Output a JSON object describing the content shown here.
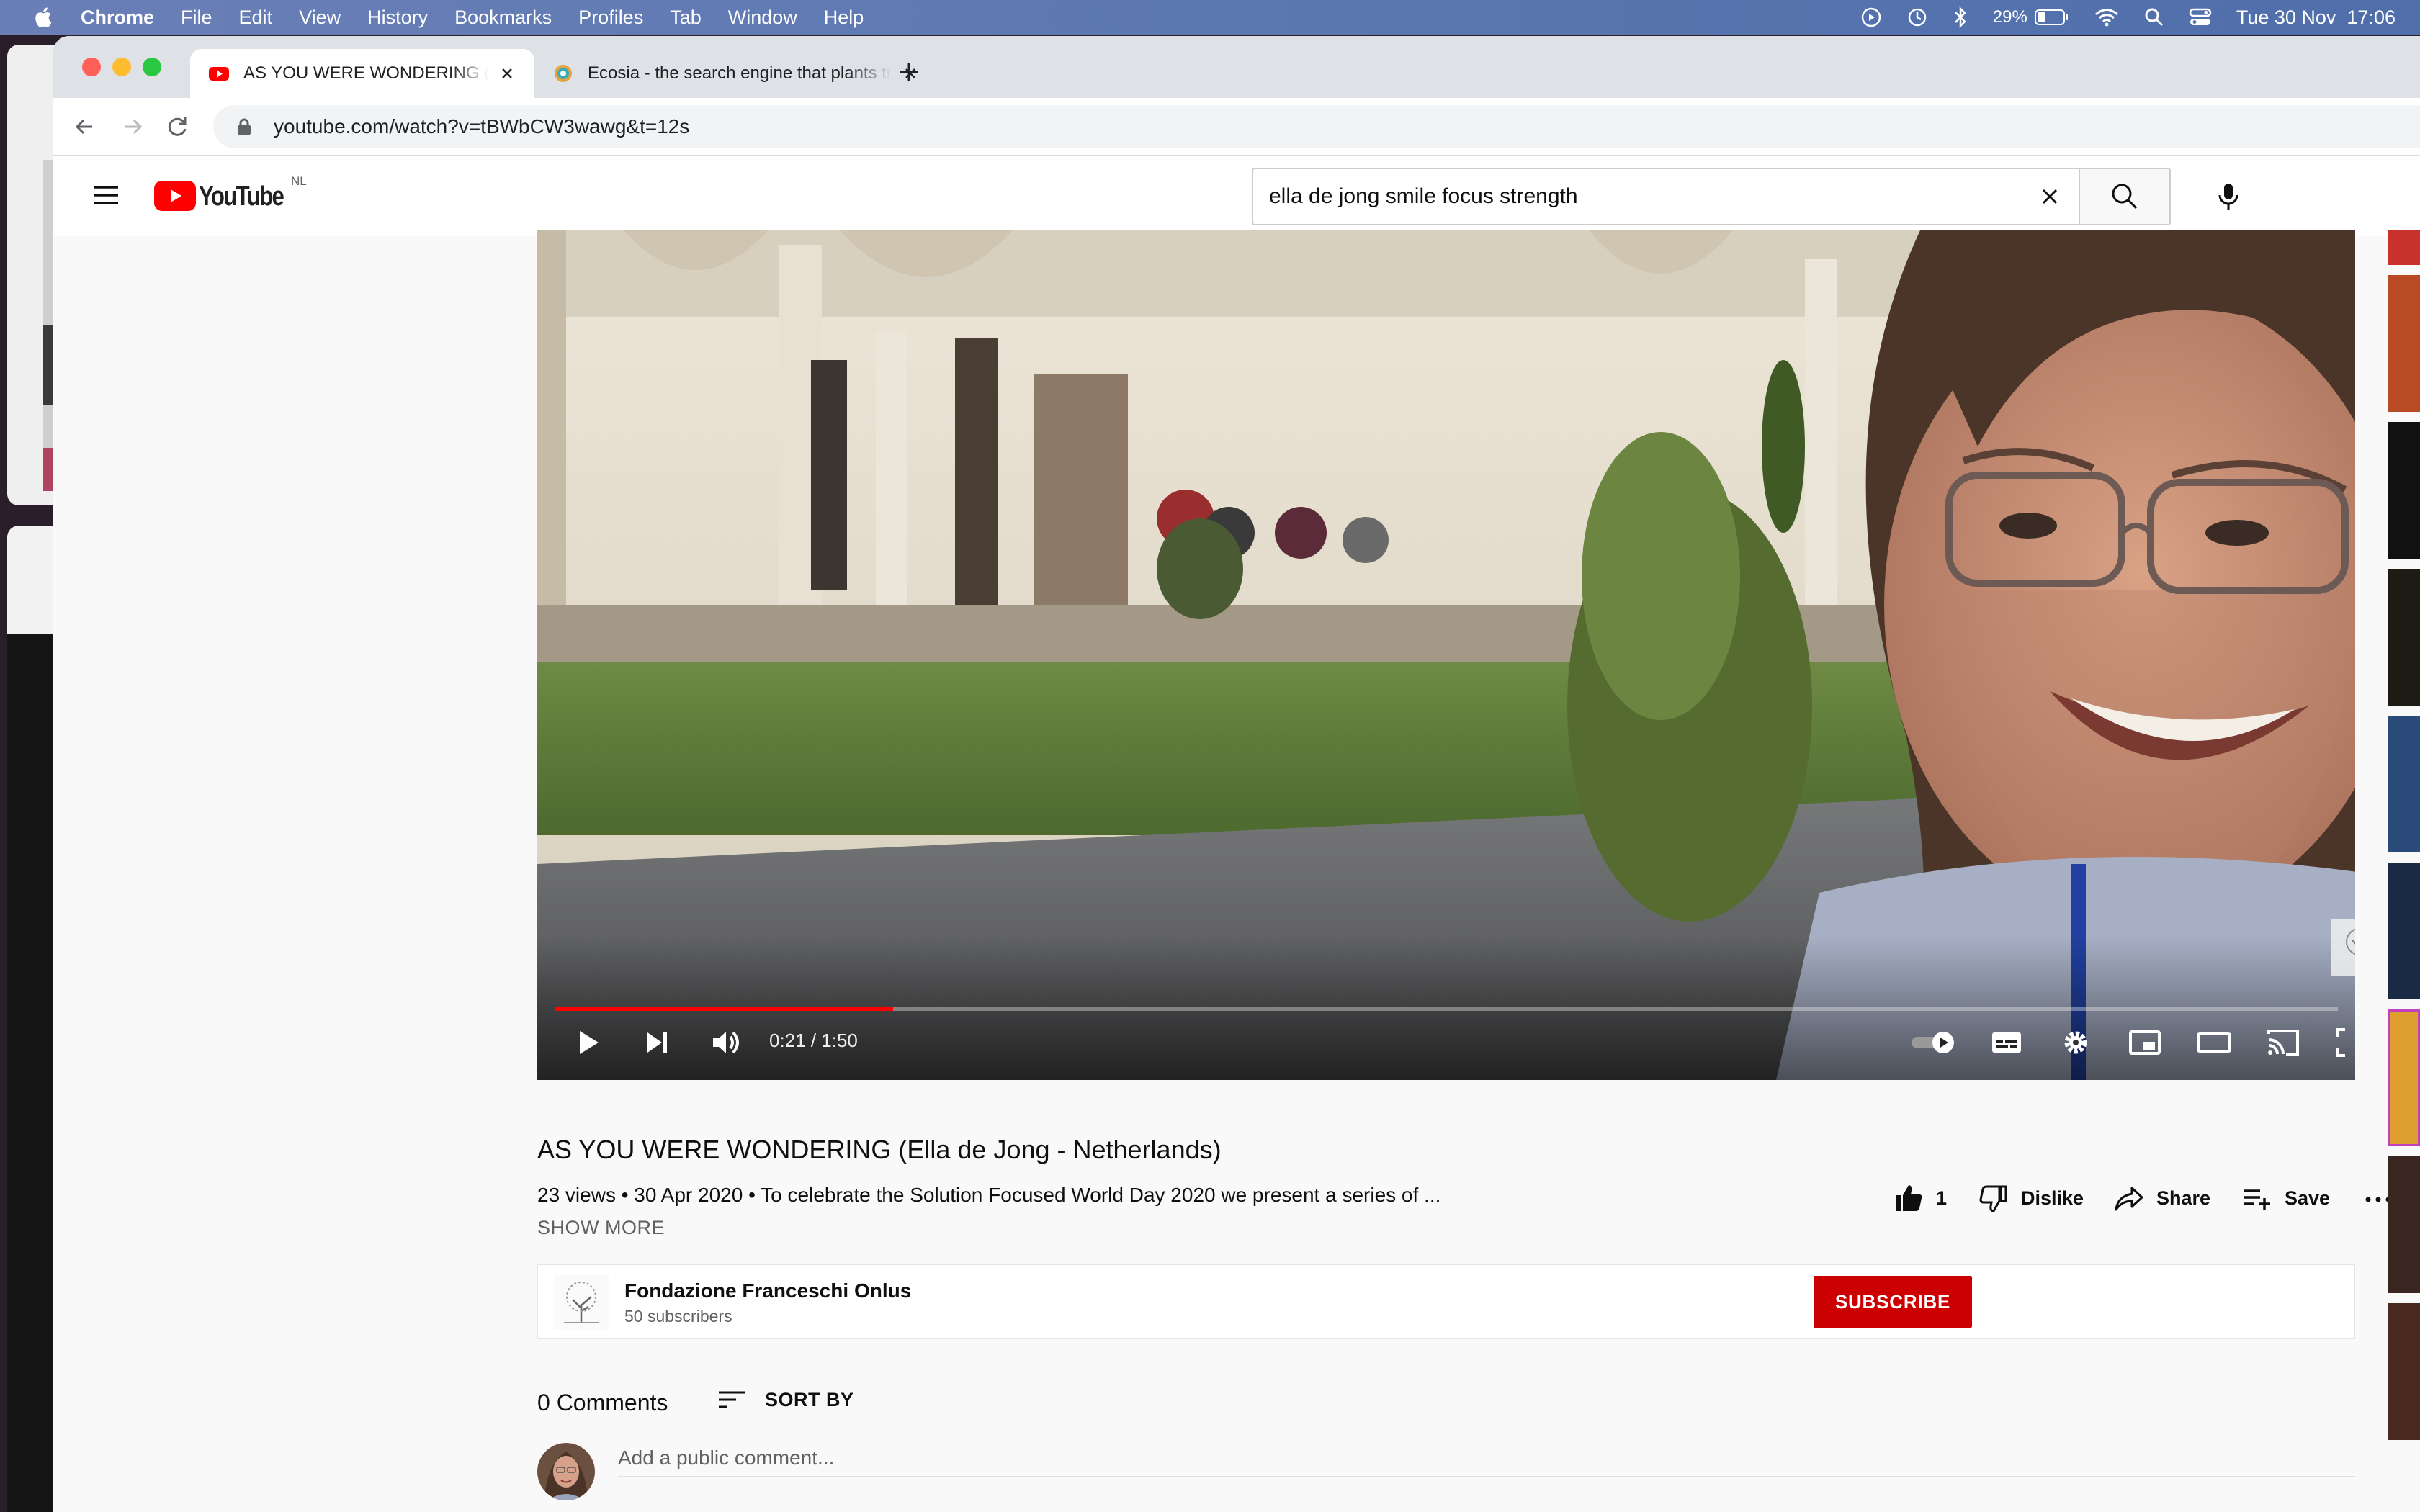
{
  "menubar": {
    "app_name": "Chrome",
    "items": [
      "File",
      "Edit",
      "View",
      "History",
      "Bookmarks",
      "Profiles",
      "Tab",
      "Window",
      "Help"
    ],
    "battery": "29%",
    "datetime": "Tue 30 Nov  17:06"
  },
  "tabs": [
    {
      "title": "AS YOU WERE WONDERING (Ella de Jong - Netherlands) - YouTube",
      "active": true
    },
    {
      "title": "Ecosia - the search engine that plants trees",
      "active": false
    }
  ],
  "toolbar": {
    "url": "youtube.com/watch?v=tBWbCW3wawg&t=12s"
  },
  "youtube": {
    "logo_text": "YouTube",
    "region": "NL",
    "search_query": "ella de jong smile focus strength"
  },
  "player": {
    "current_time": "0:21",
    "duration": "1:50",
    "time_display": "0:21 / 1:50",
    "progress_fraction": 0.19,
    "accent_color": "#ff0000"
  },
  "video": {
    "title": "AS YOU WERE WONDERING (Ella de Jong - Netherlands)",
    "meta": "23 views • 30 Apr 2020 • To celebrate the Solution Focused World Day 2020 we present a series of ...",
    "show_more": "SHOW MORE",
    "likes": "1",
    "dislike_label": "Dislike",
    "share_label": "Share",
    "save_label": "Save"
  },
  "channel": {
    "name": "Fondazione Franceschi Onlus",
    "subscribers": "50 subscribers",
    "subscribe_label": "SUBSCRIBE",
    "subscribe_color": "#cc0000"
  },
  "comments": {
    "count_label": "0 Comments",
    "sort_label": "SORT BY",
    "placeholder": "Add a public comment..."
  }
}
